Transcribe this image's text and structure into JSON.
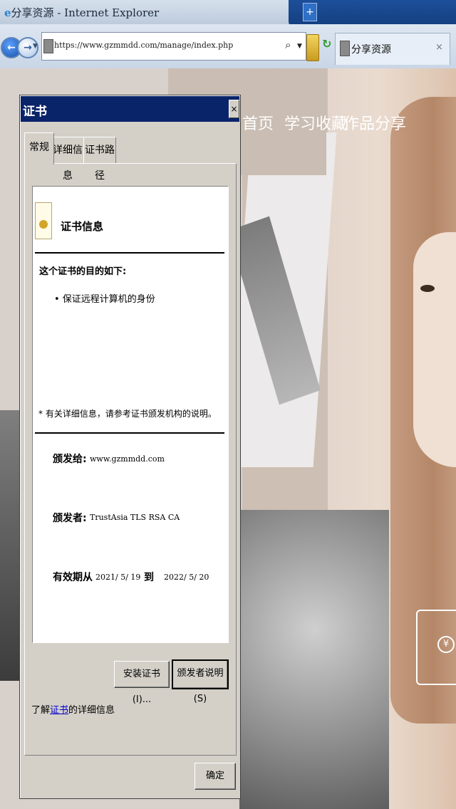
{
  "window": {
    "title": "分享资源 - Internet Explorer"
  },
  "browser": {
    "address": "https://www.gzmmdd.com/manage/index.php",
    "tab_title": "分享资源",
    "tab_close": "×",
    "new_tab": "+"
  },
  "webpage": {
    "nav": {
      "home": "首页",
      "study": "学习收藏",
      "works": "作品分享"
    }
  },
  "cert": {
    "title": "证书",
    "close": "×",
    "tabs": [
      "常规",
      "详细信息",
      "证书路径"
    ],
    "info_title": "证书信息",
    "purpose_title": "这个证书的目的如下:",
    "purposes": [
      "• 保证远程计算机的身份"
    ],
    "note": "* 有关详细信息，请参考证书颁发机构的说明。",
    "issued_to_label": "颁发给:",
    "issued_to": "www.gzmmdd.com",
    "issued_by_label": "颁发者:",
    "issued_by": "TrustAsia TLS RSA CA",
    "validity_label": "有效期从",
    "valid_from": "2021/ 5/ 19",
    "valid_to_word": "到",
    "valid_to": "2022/ 5/ 20",
    "install_button": "安装证书(I)...",
    "issuer_statement_button": "颁发者说明(S)",
    "learn_prefix": "了解",
    "learn_link": "证书",
    "learn_suffix": "的详细信息",
    "ok_button": "确定"
  }
}
